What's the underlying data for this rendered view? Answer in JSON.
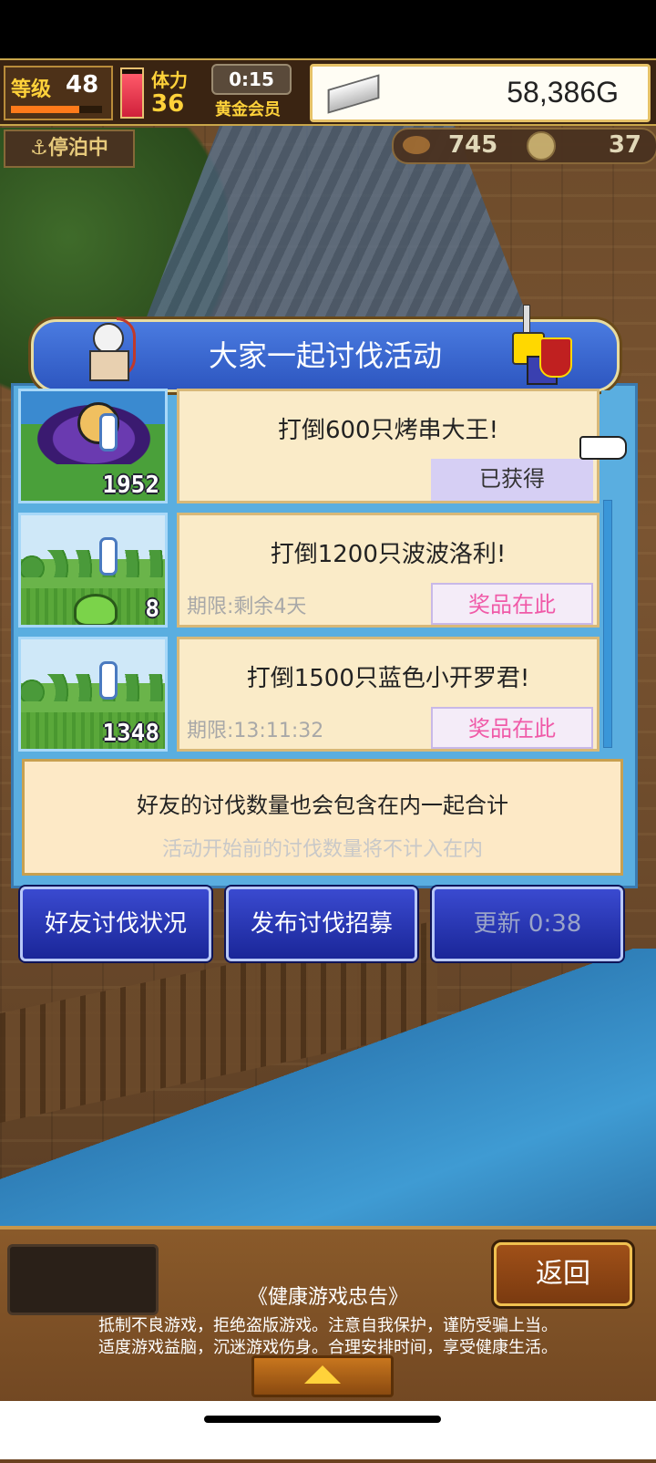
{
  "hud": {
    "level_label": "等级",
    "level_value": "48",
    "stamina_label": "体力",
    "stamina_value": "36",
    "timer": "0:15",
    "membership": "黄金会员",
    "money": "58,386G",
    "ingot_icon": "silver-ingot-icon"
  },
  "status": {
    "moored": "⚓停泊中",
    "res1_icon": "meat-icon",
    "res1_value": "745",
    "res2_icon": "coin-icon",
    "res2_value": "37"
  },
  "event": {
    "title": "大家一起讨伐活动",
    "missions": [
      {
        "title": "打倒600只烤串大王!",
        "count": "1952",
        "deadline": "",
        "button": "已获得",
        "state": "done"
      },
      {
        "title": "打倒1200只波波洛利!",
        "count": "8",
        "deadline": "期限:剩余4天",
        "button": "奖品在此",
        "state": "prize"
      },
      {
        "title": "打倒1500只蓝色小开罗君!",
        "count": "1348",
        "deadline": "期限:13:11:32",
        "button": "奖品在此",
        "state": "prize"
      }
    ],
    "info_line1": "好友的讨伐数量也会包含在内一起合计",
    "info_line2": "活动开始前的讨伐数量将不计入在内"
  },
  "actions": {
    "friends": "好友讨伐状况",
    "recruit": "发布讨伐招募",
    "refresh": "更新 0:38"
  },
  "bottom": {
    "back": "返回",
    "notice_title": "《健康游戏忠告》",
    "notice_line1": "抵制不良游戏，拒绝盗版游戏。注意自我保护，谨防受骗上当。",
    "notice_line2": "适度游戏益脑，沉迷游戏伤身。合理安排时间，享受健康生活。"
  },
  "colors": {
    "panel_blue": "#5aaee0",
    "card_cream": "#faebc8",
    "prize_pink": "#f05aa8",
    "button_blue": "#2a38b8",
    "gold": "#ffd23a"
  }
}
